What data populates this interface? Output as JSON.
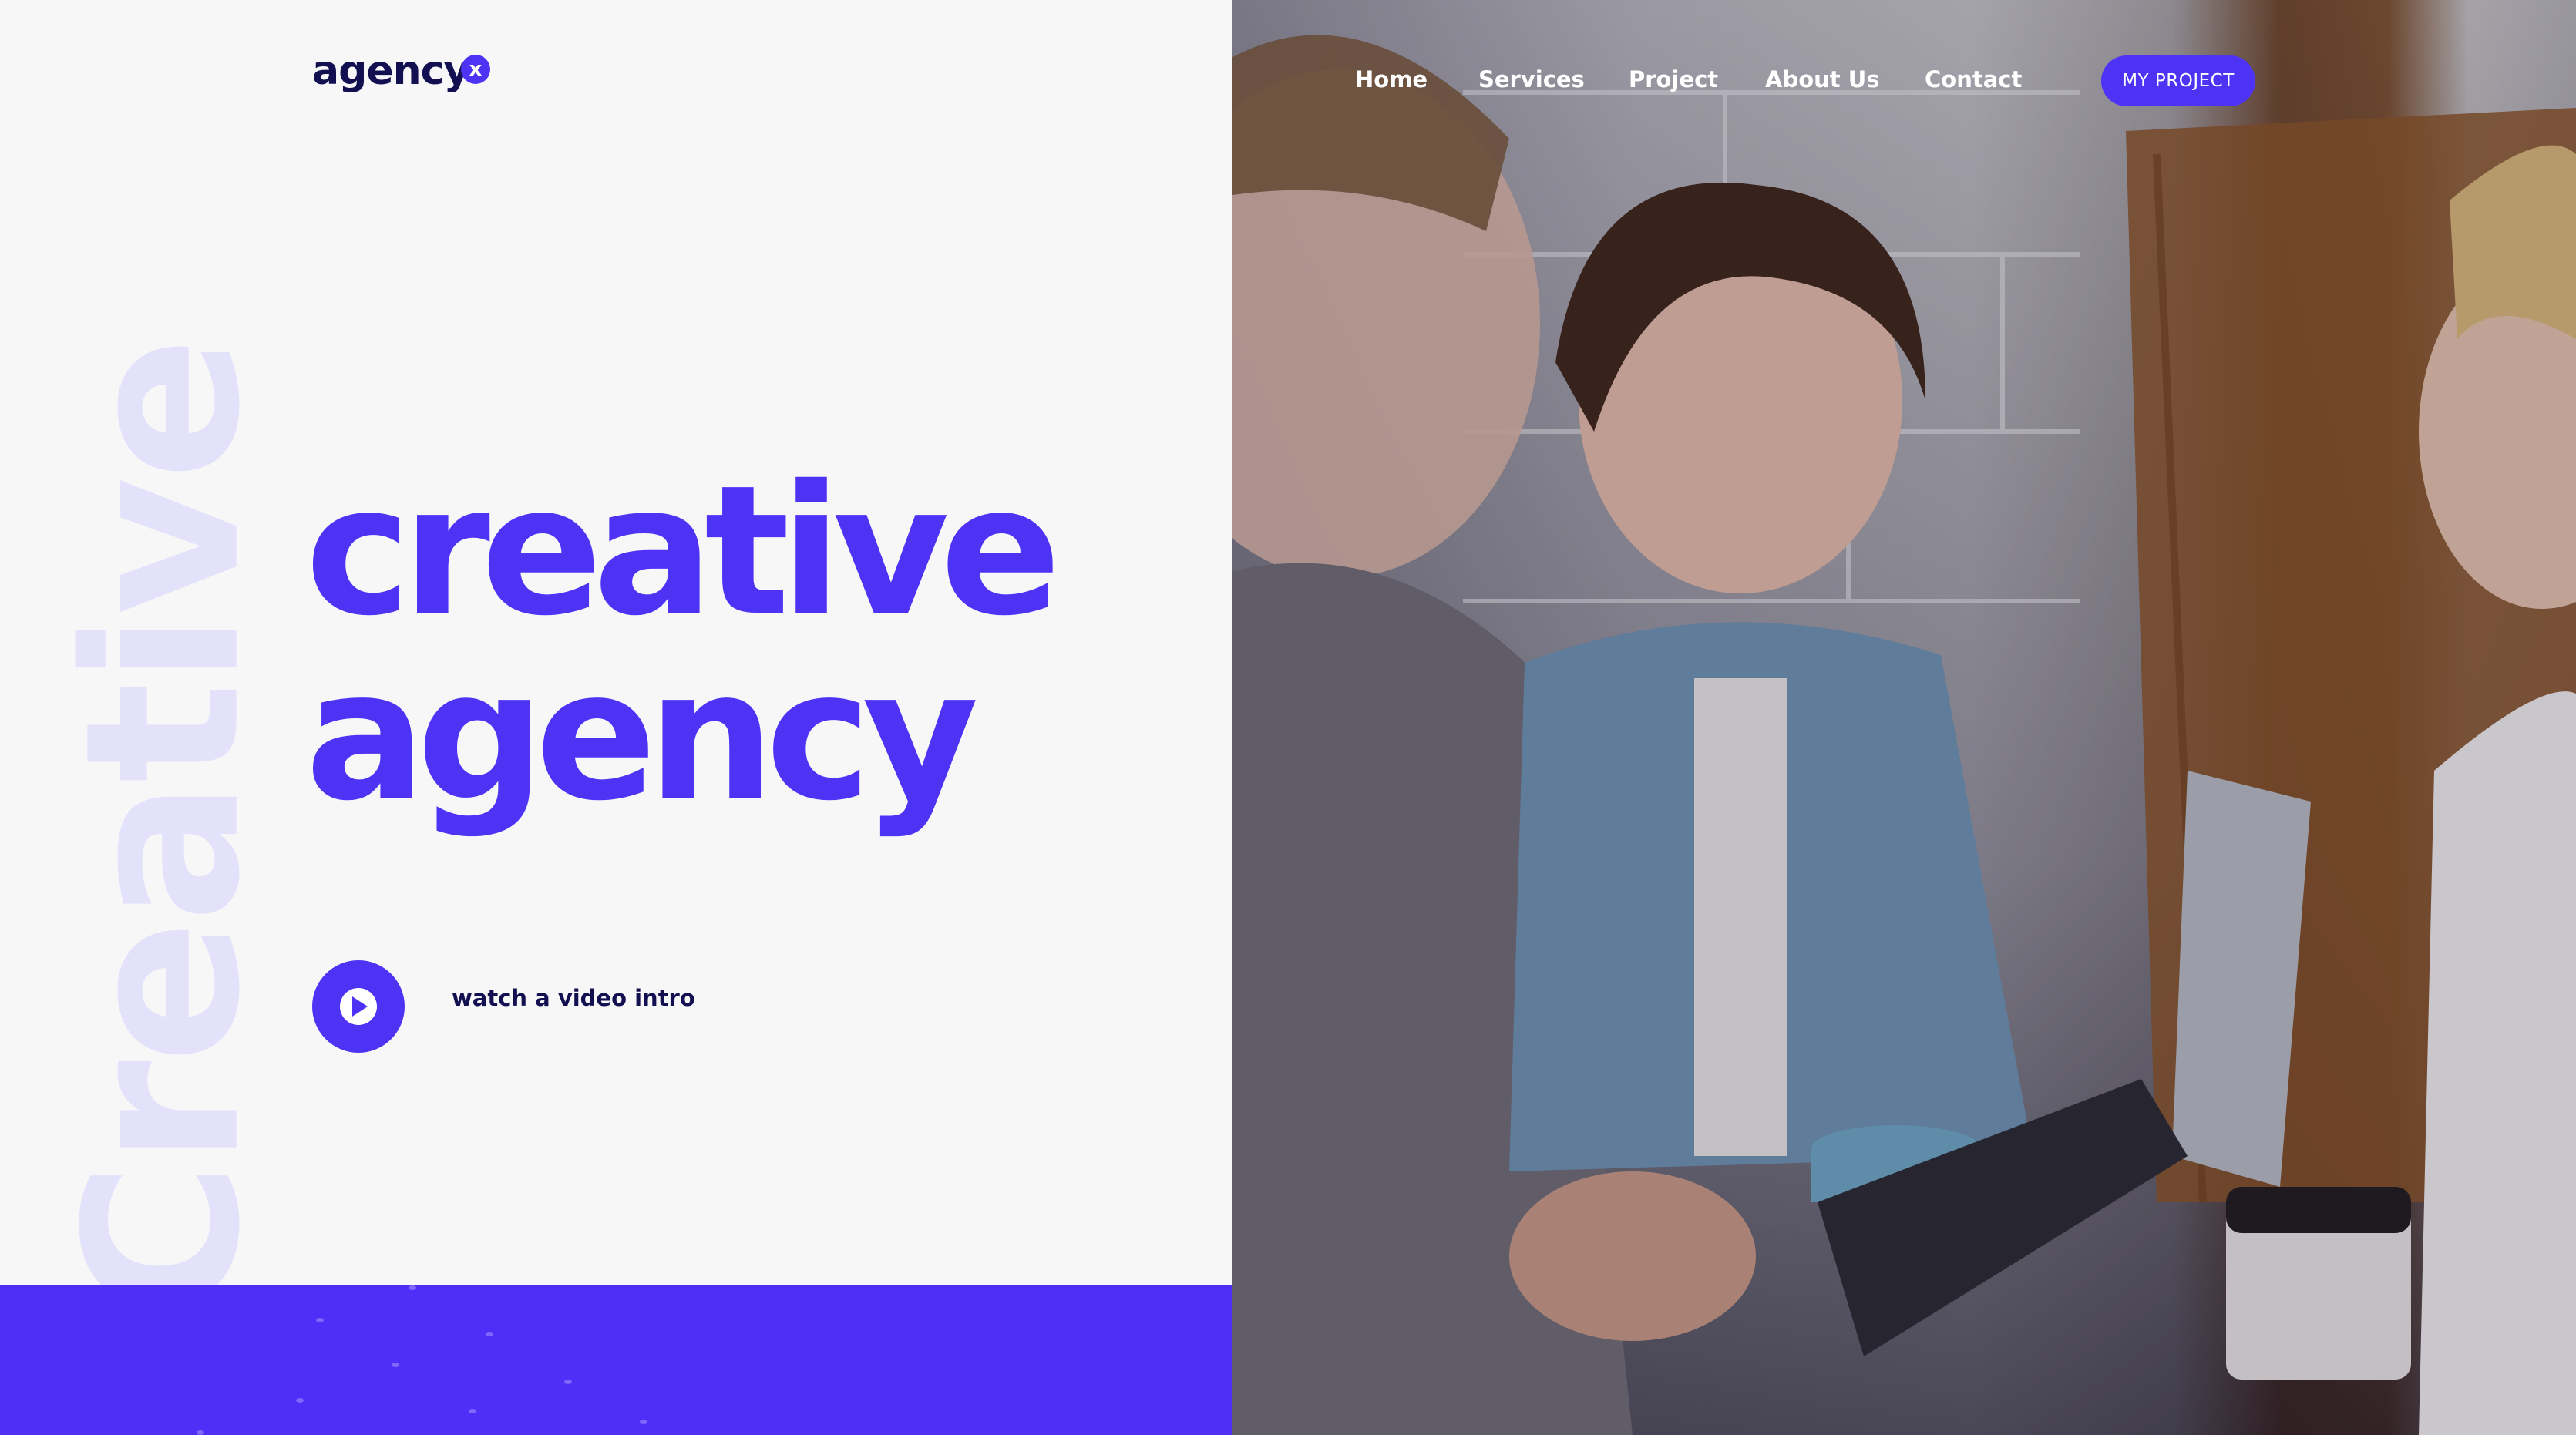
{
  "brand": {
    "logo_text": "agency",
    "logo_badge": "x",
    "accent_color": "#4f33f5",
    "dark_color": "#131052"
  },
  "nav": {
    "items": [
      {
        "label": "Home"
      },
      {
        "label": "Services"
      },
      {
        "label": "Project"
      },
      {
        "label": "About Us"
      },
      {
        "label": "Contact"
      }
    ],
    "cta_label": "MY PROJECT"
  },
  "hero": {
    "watermark": "Creative",
    "title_line1": "creative",
    "title_line2": "agency",
    "video_label": "watch a video intro",
    "play_icon": "play-icon"
  },
  "image": {
    "subject": "people-meeting-photo"
  }
}
